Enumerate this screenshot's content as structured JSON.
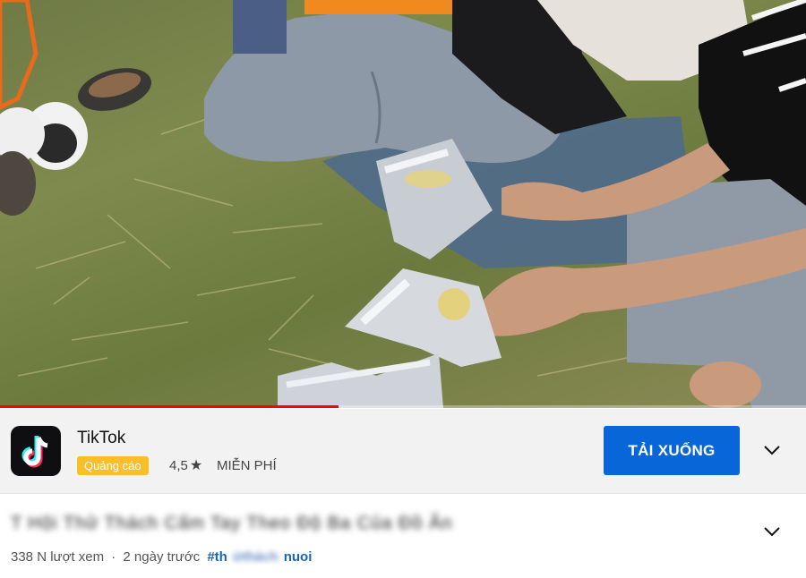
{
  "video": {
    "description": "",
    "progress_fraction": 0.42
  },
  "ad": {
    "app_name": "TikTok",
    "badge": "Quảng cáo",
    "rating": "4,5",
    "rating_star": "★",
    "price": "MIỄN PHÍ",
    "install_label": "TẢI XUỐNG",
    "icon": "tiktok-logo-icon",
    "accent": "#0866d8",
    "badge_color": "#f6c026"
  },
  "info": {
    "title": "T      Hội Thử Thách Cấm Tay Theo Độ Ba Của Đồ Ăn",
    "views": "338 N lượt xem",
    "separator": "·",
    "age": "2 ngày trước",
    "hashtag_start": "#th",
    "hashtag_hidden": "ửthách",
    "hashtag_end": "nuoi",
    "expand_icon": "chevron-down-icon"
  }
}
